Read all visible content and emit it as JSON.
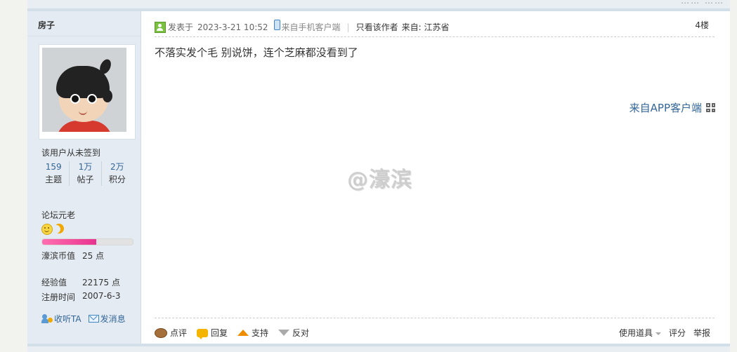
{
  "top_strip": {
    "right_text": "…… ……"
  },
  "author": {
    "name": "房子",
    "signin_status": "该用户从未签到",
    "stats": [
      {
        "value": "159",
        "label": "主题"
      },
      {
        "value": "1万",
        "label": "帖子"
      },
      {
        "value": "2万",
        "label": "积分"
      }
    ],
    "rank_title": "论坛元老",
    "level_progress_fraction": 0.6,
    "coins_label": "濠滨币值",
    "coins_value": "25 点",
    "exp_label": "经验值",
    "exp_value": "22175 点",
    "reg_label": "注册时间",
    "reg_value": "2007-6-3",
    "follow_label": "收听TA",
    "message_label": "发消息",
    "icons": [
      "online-status-icon",
      "phone-icon",
      "follow-icon",
      "mail-icon",
      "smile-medal-icon",
      "moon-medal-icon"
    ]
  },
  "post": {
    "posted_label": "发表于",
    "posted_time": "2023-3-21 10:52",
    "mobile_source": "来自手机客户端",
    "only_author": "只看该作者",
    "location": "来自: 江苏省",
    "floor": "4楼",
    "body": "不落实发个毛 别说饼，连个芝麻都没看到了",
    "watermark": "@濠滨",
    "app_source": "来自APP客户端"
  },
  "actions": {
    "comment": "点评",
    "reply": "回复",
    "support": "支持",
    "oppose": "反对",
    "use_tool": "使用道具",
    "rate": "评分",
    "report": "举报"
  },
  "colors": {
    "sidebar_bg": "#e4ebf2",
    "link_blue": "#336699",
    "page_bg": "#f2f3ee",
    "progress_pink": "#e8338f"
  }
}
